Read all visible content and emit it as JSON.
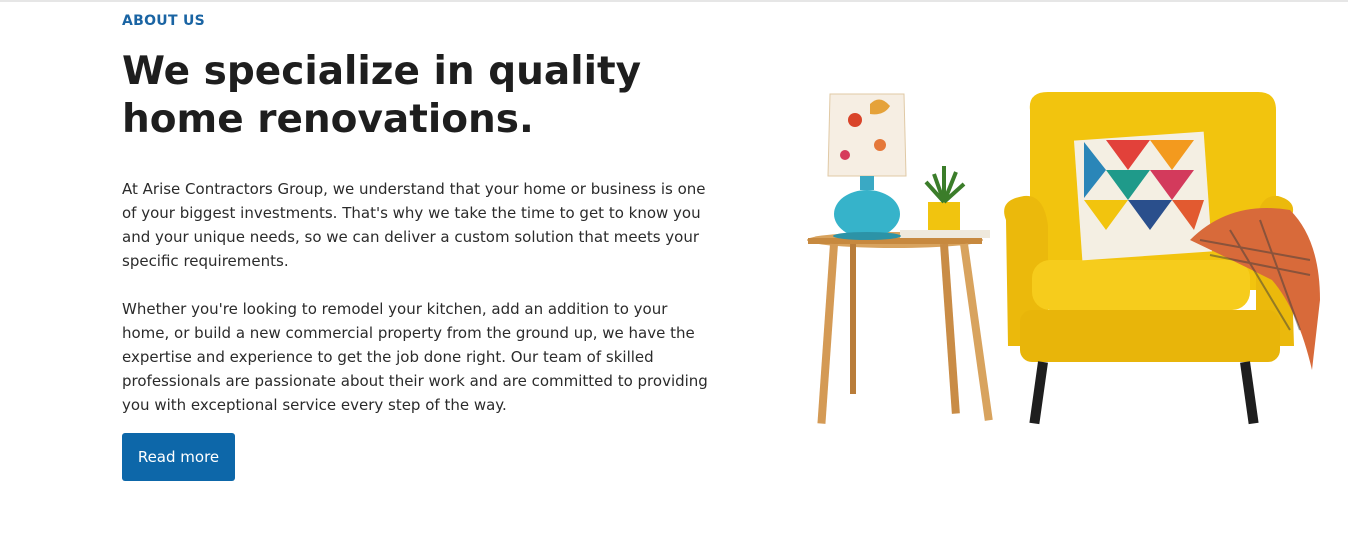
{
  "about": {
    "eyebrow": "ABOUT US",
    "title": "We specialize in quality home renovations.",
    "paragraph_1": "At Arise Contractors Group, we understand that your home or business is one of your biggest investments. That's why we take the time to get to know you and your unique needs, so we can deliver a custom solution that meets your specific requirements.",
    "paragraph_2": "Whether you're looking to remodel your kitchen, add an addition to your home, or build a new commercial property from the ground up, we have the expertise and experience to get the job done right. Our team of skilled professionals are passionate about their work and are committed to providing you with exceptional service every step of the way.",
    "button_label": "Read more"
  },
  "colors": {
    "accent": "#0d67a9",
    "eyebrow": "#1a64a3",
    "chair_yellow": "#f2c40e"
  },
  "image": {
    "icon": "armchair-illustration"
  }
}
